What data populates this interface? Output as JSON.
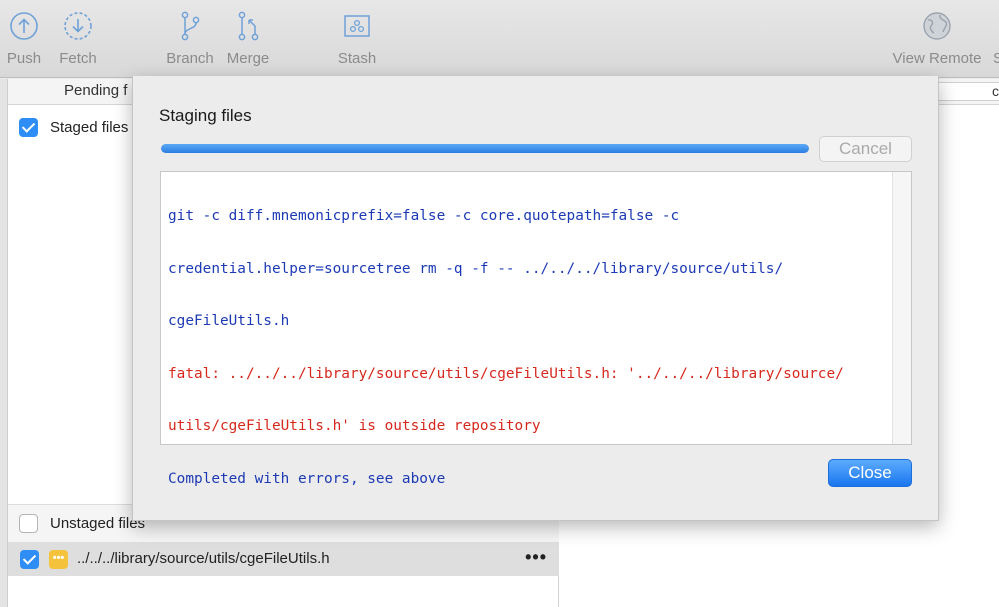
{
  "toolbar": {
    "push": "Push",
    "fetch": "Fetch",
    "branch": "Branch",
    "merge": "Merge",
    "stash": "Stash",
    "view_remote": "View Remote",
    "settings_partial": "S"
  },
  "pending": {
    "label": "Pending f",
    "right_partial": "c"
  },
  "staged": {
    "label": "Staged files",
    "checked": true
  },
  "unstaged": {
    "label": "Unstaged files",
    "checked": false,
    "files": [
      {
        "path": "../../../library/source/utils/cgeFileUtils.h",
        "status": "modified",
        "status_glyph": "•••",
        "checked": true,
        "more": "•••"
      }
    ]
  },
  "dialog": {
    "title": "Staging files",
    "progress_percent": 100,
    "cancel_label": "Cancel",
    "close_label": "Close",
    "log": {
      "command_lines": [
        "git -c diff.mnemonicprefix=false -c core.quotepath=false -c",
        "credential.helper=sourcetree rm -q -f -- ../../../library/source/utils/",
        "cgeFileUtils.h"
      ],
      "error_lines": [
        "fatal: ../../../library/source/utils/cgeFileUtils.h: '../../../library/source/",
        "utils/cgeFileUtils.h' is outside repository"
      ],
      "status_line": "Completed with errors, see above"
    }
  },
  "colors": {
    "accent": "#2f8df6",
    "log_command": "#1d3ab5",
    "log_error": "#d6281d",
    "modified_badge": "#f5c33b"
  }
}
